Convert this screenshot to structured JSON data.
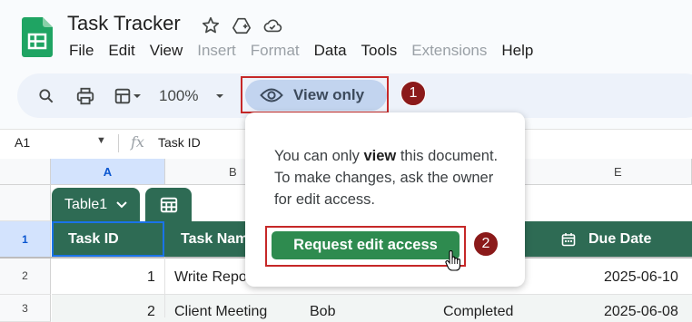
{
  "app": {
    "title": "Task Tracker"
  },
  "menu": [
    "File",
    "Edit",
    "View",
    "Insert",
    "Format",
    "Data",
    "Tools",
    "Extensions",
    "Help"
  ],
  "menu_disabled": [
    "Insert",
    "Format",
    "Extensions"
  ],
  "toolbar": {
    "zoom": "100%",
    "view_only_label": "View only"
  },
  "formula_bar": {
    "cell_ref": "A1",
    "fx": "fx",
    "value": "Task ID"
  },
  "columns": [
    "A",
    "B",
    "E"
  ],
  "rows": [
    "1",
    "2",
    "3"
  ],
  "table": {
    "name": "Table1",
    "headers": {
      "task_id": "Task ID",
      "task_name": "Task Nam",
      "due_date": "Due Date"
    },
    "row2": {
      "id": "1",
      "name": "Write Repo",
      "due": "2025-06-10"
    },
    "row3": {
      "id": "2",
      "name": "Client Meeting",
      "owner": "Bob",
      "status": "Completed",
      "due": "2025-06-08"
    }
  },
  "popup": {
    "text_before": "You can only ",
    "text_bold": "view",
    "text_after": " this document. To make changes, ask the owner for edit access.",
    "button": "Request edit access"
  },
  "annotations": {
    "step1": "1",
    "step2": "2"
  },
  "colors": {
    "table_green": "#2e6b54",
    "button_green": "#2e8b4f",
    "highlight_red": "#c62828",
    "badge": "#8b1a1a",
    "view_only_bg": "#c2d4ef"
  },
  "icons": [
    "sheets-logo-icon",
    "star-icon",
    "move-to-drive-icon",
    "cloud-status-icon",
    "search-icon",
    "print-icon",
    "format-icon",
    "eye-icon",
    "calendar-icon",
    "table-icon",
    "chevron-down-icon",
    "hand-cursor-icon"
  ]
}
